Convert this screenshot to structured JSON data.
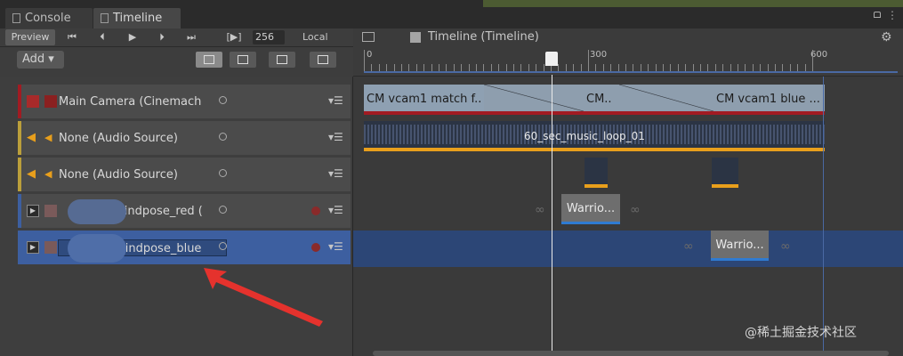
{
  "tabs": [
    {
      "label": "Console",
      "icon": "console-icon"
    },
    {
      "label": "Timeline",
      "icon": "timeline-icon"
    }
  ],
  "toolbar": {
    "preview_label": "Preview",
    "frame_value": "256",
    "space_label": "Local",
    "add_label": "Add ▾"
  },
  "header": {
    "title": "Timeline (Timeline)"
  },
  "ruler": {
    "labels": [
      "0",
      "300",
      "600"
    ]
  },
  "tracks": [
    {
      "label": "Main Camera (Cinemach",
      "color": "#a11b22",
      "selected": false
    },
    {
      "label": "None (Audio Source)",
      "color": "#e89f1c",
      "selected": false
    },
    {
      "label": "None (Audio Source)",
      "color": "#e89f1c",
      "selected": false
    },
    {
      "label": "_bindpose_red (",
      "color": "#3d5fa0",
      "selected": false
    },
    {
      "label": "_bindpose_blue",
      "color": "#3d5fa0",
      "selected": true
    }
  ],
  "clips": {
    "camera": [
      "CM vcam1 match f..",
      "CM..",
      "CM vcam1 blue ..."
    ],
    "music": "60_sec_music_loop_01",
    "anim_red": "Warrio...",
    "anim_blue": "Warrio..."
  },
  "watermark": "@稀土掘金技术社区"
}
